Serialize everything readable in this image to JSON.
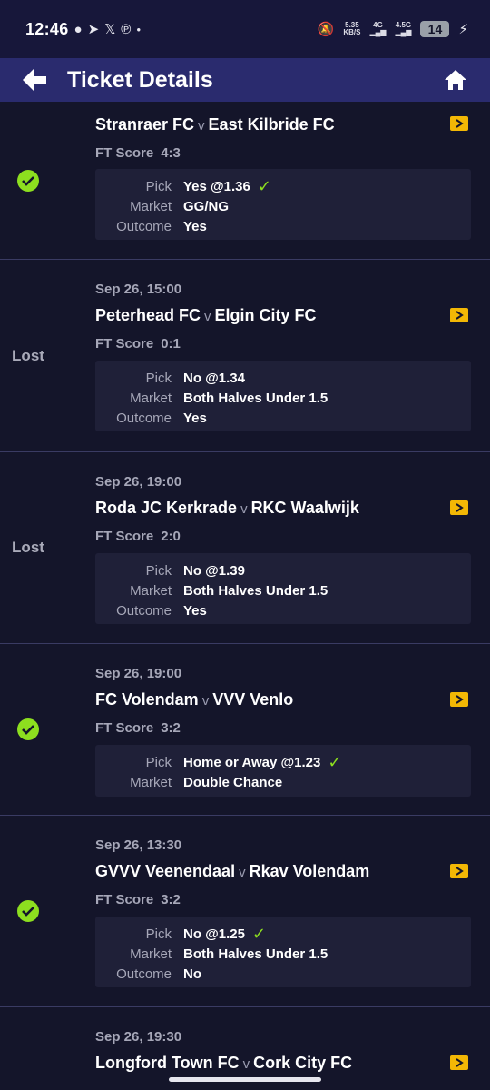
{
  "status_bar": {
    "time": "12:46",
    "net_speed_top": "5.35",
    "net_speed_bottom": "KB/S",
    "signal1": "4G",
    "signal2": "4.5G",
    "battery": "14"
  },
  "header": {
    "title": "Ticket Details"
  },
  "labels": {
    "ft": "FT Score",
    "pick": "Pick",
    "market": "Market",
    "outcome": "Outcome"
  },
  "colors": {
    "accent_green": "#8ddf1f",
    "replay_yellow": "#f2b705",
    "header_bg": "#2a2b6e"
  },
  "matches": [
    {
      "date": "",
      "home": "Stranraer FC",
      "vs": "v",
      "away": "East Kilbride FC",
      "status": "won",
      "status_text": "",
      "score": "4:3",
      "pick": "Yes @1.36",
      "market": "GG/NG",
      "outcome": "Yes"
    },
    {
      "date": "Sep 26, 15:00",
      "home": "Peterhead FC",
      "vs": "v",
      "away": "Elgin City FC",
      "status": "lost",
      "status_text": "Lost",
      "score": "0:1",
      "pick": "No @1.34",
      "market": "Both Halves Under 1.5",
      "outcome": "Yes"
    },
    {
      "date": "Sep 26, 19:00",
      "home": "Roda JC Kerkrade",
      "vs": "v",
      "away": "RKC Waalwijk",
      "status": "lost",
      "status_text": "Lost",
      "score": "2:0",
      "pick": "No @1.39",
      "market": "Both Halves Under 1.5",
      "outcome": "Yes"
    },
    {
      "date": "Sep 26, 19:00",
      "home": "FC Volendam",
      "vs": "v",
      "away": "VVV Venlo",
      "status": "won",
      "status_text": "",
      "score": "3:2",
      "pick": "Home or Away @1.23",
      "market": "Double Chance",
      "outcome": ""
    },
    {
      "date": "Sep 26, 13:30",
      "home": "GVVV Veenendaal",
      "vs": "v",
      "away": "Rkav Volendam",
      "status": "won",
      "status_text": "",
      "score": "3:2",
      "pick": "No @1.25",
      "market": "Both Halves Under 1.5",
      "outcome": "No"
    },
    {
      "date": "Sep 26, 19:30",
      "home": "Longford Town FC",
      "vs": "v",
      "away": "Cork City FC",
      "status": "",
      "status_text": "",
      "score": "",
      "pick": "",
      "market": "",
      "outcome": ""
    }
  ]
}
